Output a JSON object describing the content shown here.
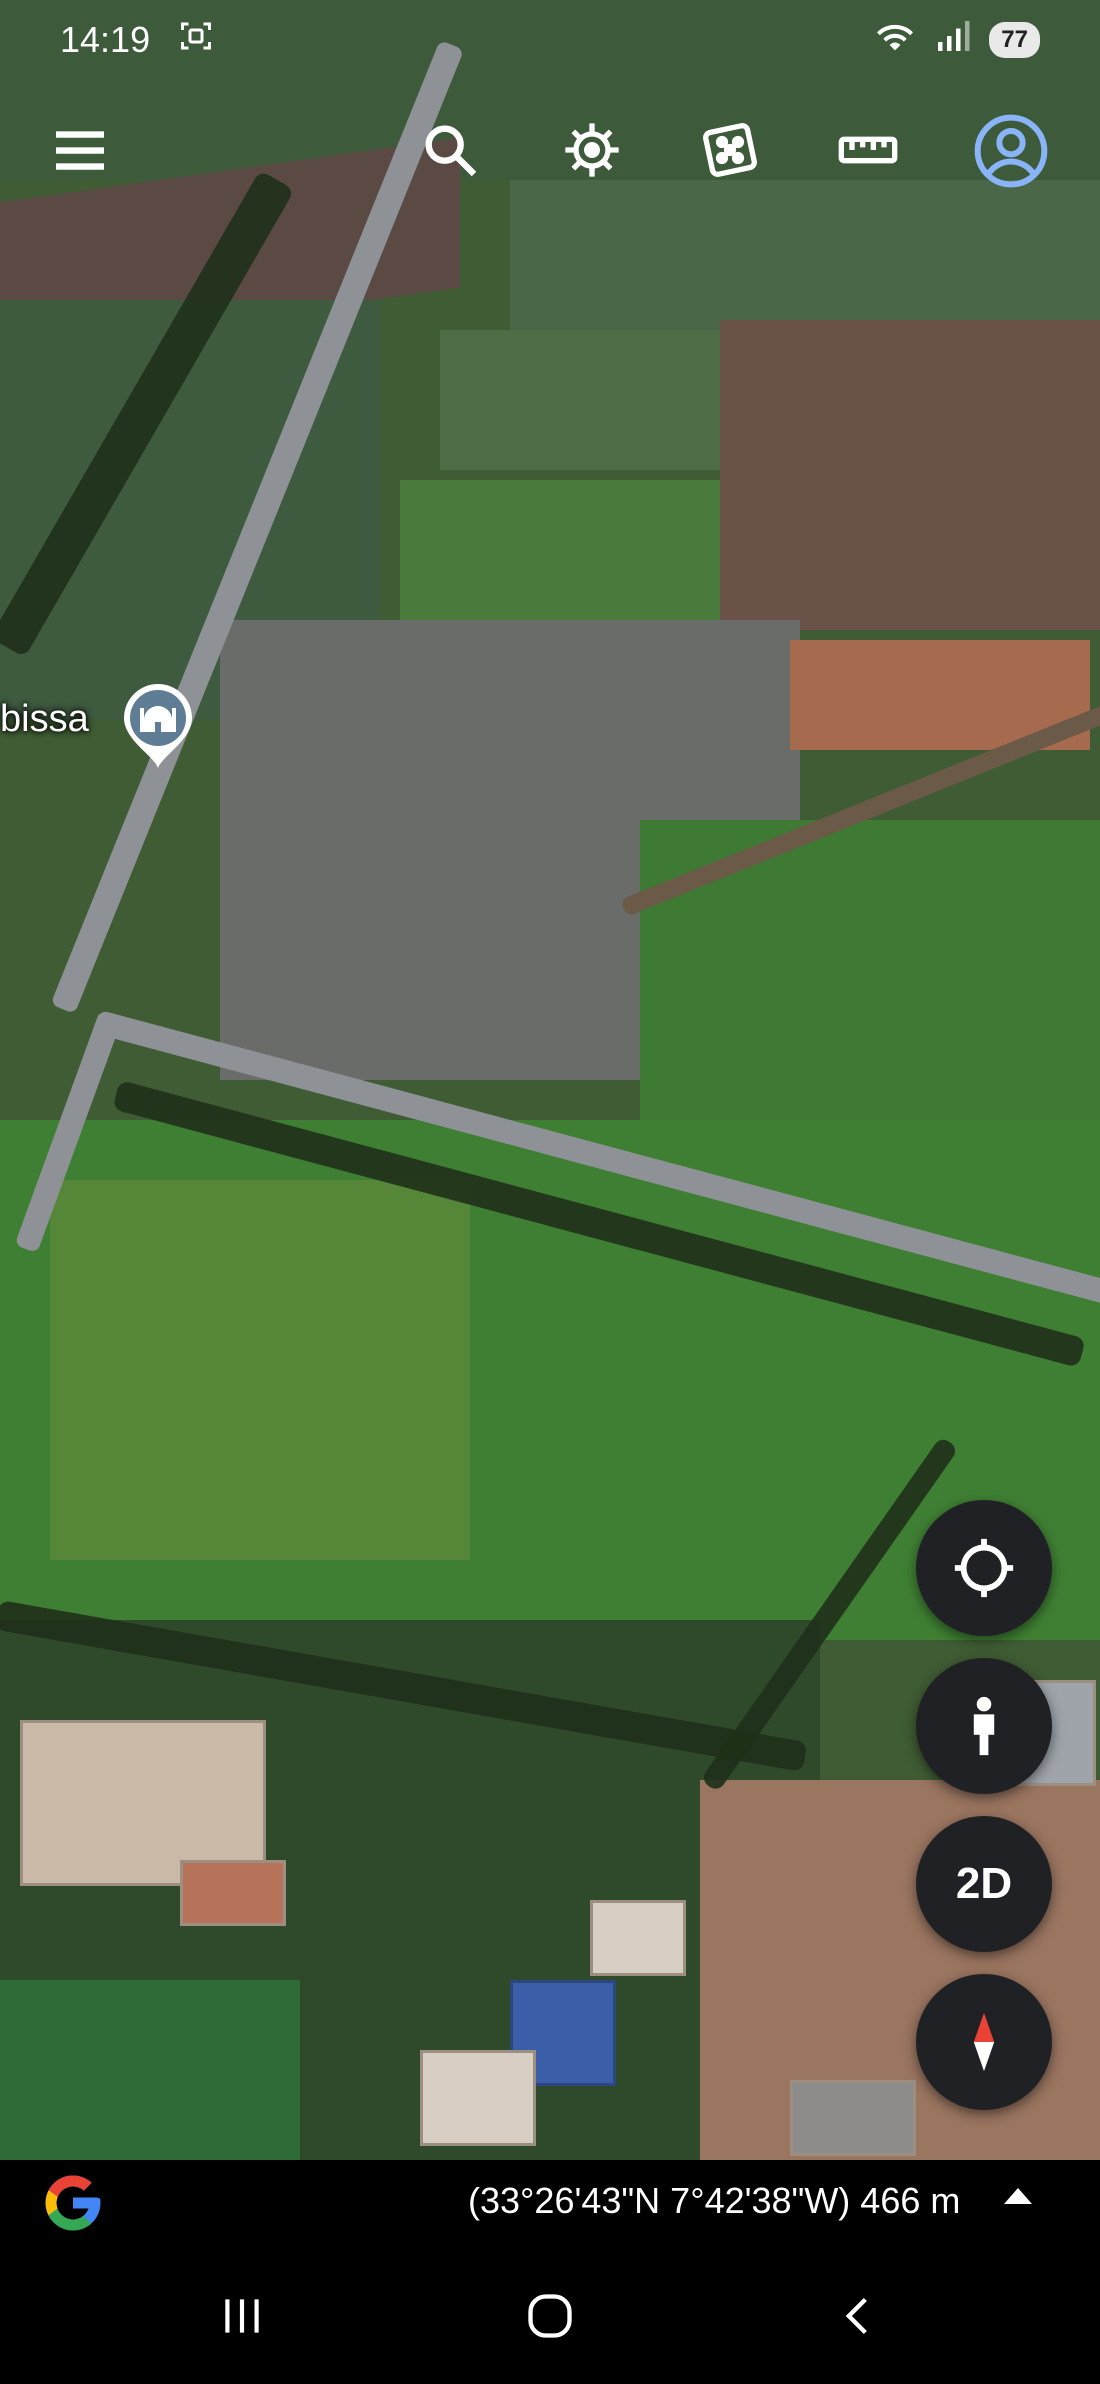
{
  "status": {
    "time": "14:19",
    "battery": "77"
  },
  "toolbar": {
    "icons": [
      "menu-icon",
      "search-icon",
      "voyager-icon",
      "random-icon",
      "measure-icon",
      "account-icon"
    ]
  },
  "map": {
    "place_label": "bissa",
    "place_icon": "mosque-icon"
  },
  "controls": {
    "view_mode_label": "2D",
    "icons": [
      "my-location-icon",
      "street-view-icon",
      "compass-icon"
    ]
  },
  "footer": {
    "coordinates": "(33°26'43\"N 7°42'38\"W) 466 m",
    "logo": "google-logo",
    "accent_colors": [
      "#4285F4",
      "#EA4335",
      "#FBBC05",
      "#34A853"
    ]
  },
  "colors": {
    "accent": "#8ab4f8",
    "fab_background": "#202124"
  }
}
